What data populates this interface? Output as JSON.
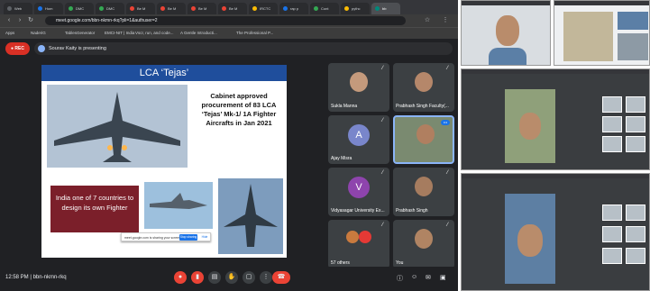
{
  "browser": {
    "tabs": [
      {
        "label": "Web",
        "color": "#5f6368"
      },
      {
        "label": "Hom",
        "color": "#1a73e8"
      },
      {
        "label": "DMC",
        "color": "#34a853"
      },
      {
        "label": "DMC",
        "color": "#34a853"
      },
      {
        "label": "Be M",
        "color": "#ea4335"
      },
      {
        "label": "Be M",
        "color": "#ea4335"
      },
      {
        "label": "Be M",
        "color": "#ea4335"
      },
      {
        "label": "Be M",
        "color": "#ea4335"
      },
      {
        "label": "IRCTC",
        "color": "#fbbc04"
      },
      {
        "label": "rap p",
        "color": "#1a73e8"
      },
      {
        "label": "Cont",
        "color": "#34a853"
      },
      {
        "label": "pythc",
        "color": "#fbbc04"
      },
      {
        "label": "bb",
        "color": "#00897b",
        "active": true
      }
    ],
    "url": "meet.google.com/bbn-nkmn-rkq?pli=1&authuser=2",
    "bookmarks": [
      "Apps",
      "NaderiG",
      "TablesGenerator",
      "EMCI-NIT | India",
      "Vscr, run, and code...",
      "A Gentle Introducti...",
      "The Professional P..."
    ]
  },
  "meet": {
    "rec_label": "REC",
    "presenting_text": "Sourav Kaity is presenting",
    "slide": {
      "title": "LCA ‘Tejas’",
      "cabinet_text": "Cabinet approved procurement of 83 LCA ‘Tejas’ Mk-1/ 1A Fighter Aircrafts in Jan 2021",
      "india_text": "India one of 7 countries to design its own Fighter",
      "share_notice": "meet.google.com is sharing your screen",
      "share_button": "Stop sharing",
      "hide_button": "Hide"
    },
    "participants": [
      {
        "name": "Sukla Manna",
        "type": "video"
      },
      {
        "name": "Prabhash Singh Faculty(...",
        "type": "video"
      },
      {
        "name": "Ajay Misra",
        "type": "letter",
        "letter": "A",
        "color": "#7986cb"
      },
      {
        "name": "",
        "type": "speaking"
      },
      {
        "name": "Vidyasagar University Ex...",
        "type": "letter",
        "letter": "V",
        "color": "#8e44ad"
      },
      {
        "name": "Prabhash Singh",
        "type": "video"
      },
      {
        "name": "57 others",
        "type": "others"
      },
      {
        "name": "You",
        "type": "video"
      }
    ],
    "time": "12:58 PM",
    "meeting_code": "bbn-nkmn-rkq"
  }
}
